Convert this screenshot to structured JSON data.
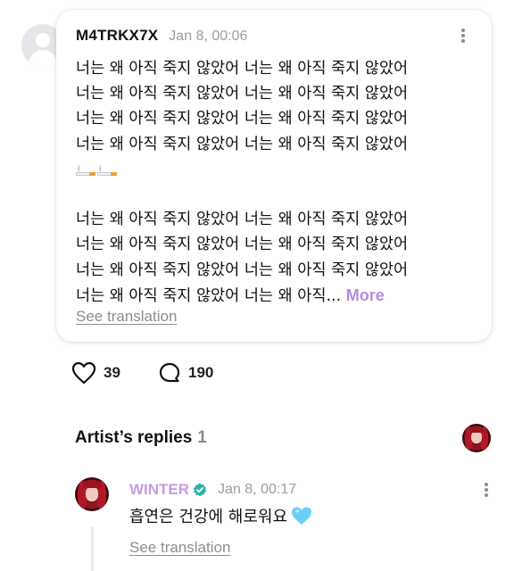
{
  "comment": {
    "username": "M4TRKX7X",
    "timestamp": "Jan 8, 00:06",
    "paragraph1": "너는 왜 아직 죽지 않았어 너는 왜 아직 죽지 않았어\n너는 왜 아직 죽지 않았어 너는 왜 아직 죽지 않았어\n너는 왜 아직 죽지 않았어 너는 왜 아직 죽지 않았어\n너는 왜 아직 죽지 않았어 너는 왜 아직 죽지 않았어",
    "emoji_icons": [
      "cigarette-icon",
      "cigarette-icon"
    ],
    "paragraph2": "너는 왜 아직 죽지 않았어 너는 왜 아직 죽지 않았어\n너는 왜 아직 죽지 않았어 너는 왜 아직 죽지 않았어\n너는 왜 아직 죽지 않았어 너는 왜 아직 죽지 않았어\n너는 왜 아직 죽지 않았어 너는 왜 아직...",
    "more_label": "More",
    "see_translation": "See translation",
    "likes": "39",
    "replies": "190"
  },
  "artist_replies": {
    "title": "Artist’s replies",
    "count": "1"
  },
  "reply": {
    "artist_name": "WINTER",
    "timestamp": "Jan 8, 00:17",
    "text": "흡연은 건강에 해로워요",
    "emoji_icon": "blue-heart-icon",
    "see_translation": "See translation"
  },
  "colors": {
    "accent_purple": "#c59be6",
    "more_purple": "#b58be0",
    "verified_teal": "#2bb3a3",
    "heart_blue": "#6ccff6"
  }
}
